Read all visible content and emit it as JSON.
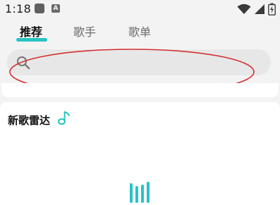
{
  "status_bar": {
    "time": "1:18",
    "notification_badge": "A",
    "icons": [
      "message-icon",
      "a-notification-icon",
      "wifi-icon",
      "signal-icon",
      "battery-icon"
    ]
  },
  "tabs": [
    {
      "label": "推荐",
      "active": true
    },
    {
      "label": "歌手",
      "active": false
    },
    {
      "label": "歌单",
      "active": false
    }
  ],
  "search": {
    "value": "",
    "placeholder": ""
  },
  "section": {
    "title": "新歌雷达"
  },
  "colors": {
    "accent": "#27c3c3",
    "annotation": "#d32f2f",
    "background": "#f3f3f3",
    "card": "#ffffff"
  }
}
